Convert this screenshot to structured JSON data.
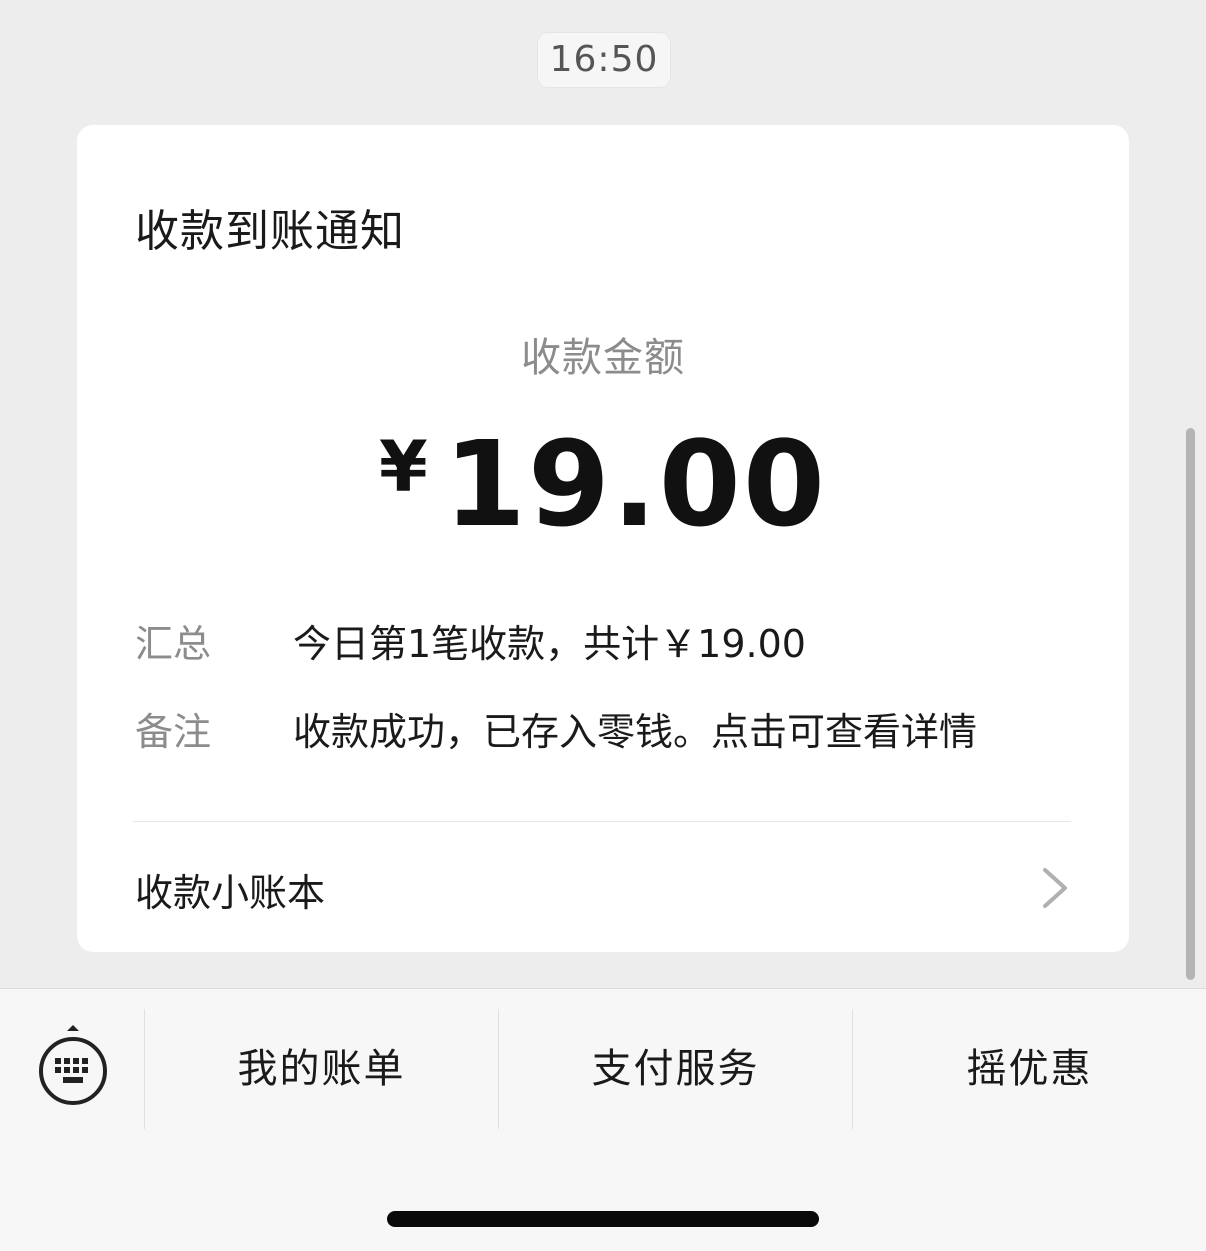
{
  "timestamp": "16:50",
  "card": {
    "title": "收款到账通知",
    "amount_label": "收款金额",
    "currency_symbol": "¥",
    "amount": "19.00",
    "rows": [
      {
        "key": "汇总",
        "value": "今日第1笔收款，共计￥19.00"
      },
      {
        "key": "备注",
        "value": "收款成功，已存入零钱。点击可查看详情"
      }
    ],
    "ledger_label": "收款小账本",
    "ledger_icon": "chevron-right-icon"
  },
  "bottom_menu": {
    "keyboard_icon": "keyboard-icon",
    "items": [
      {
        "label": "我的账单"
      },
      {
        "label": "支付服务"
      },
      {
        "label": "摇优惠"
      }
    ]
  }
}
